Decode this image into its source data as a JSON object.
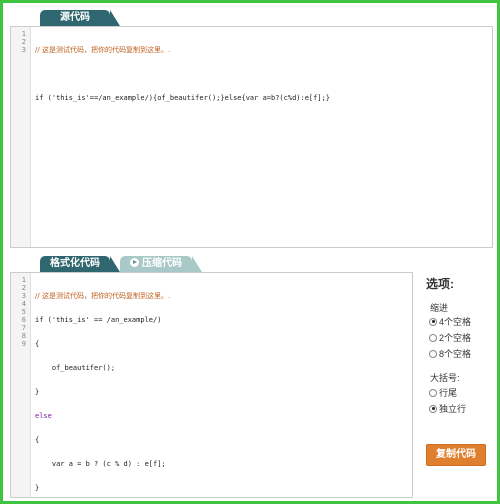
{
  "tabs": {
    "source": "源代码",
    "formatted": "格式化代码",
    "minified": "压缩代码"
  },
  "source_editor": {
    "line_numbers": [
      "1",
      "2",
      "3"
    ],
    "lines": [
      {
        "comment": "// 这是测试代码，把你的代码复制到这里。."
      },
      {
        "text": ""
      },
      {
        "text": "if ('this_is'==/an_example/){of_beautifer();}else{var a=b?(c%d):e[f];}"
      }
    ]
  },
  "formatted_editor": {
    "line_numbers": [
      "1",
      "2",
      "3",
      "4",
      "5",
      "6",
      "7",
      "8",
      "9"
    ],
    "line1_comment": "// 这是测试代码，把你的代码复制到这里。.",
    "line2": "if ('this_is' == /an_example/)",
    "line3": "{",
    "line4": "    of_beautifer();",
    "line5": "}",
    "line6": "else",
    "line7": "{",
    "line8": "    var a = b ? (c % d) : e[f];",
    "line9": "}"
  },
  "options": {
    "title": "选项:",
    "indent_label": "缩进",
    "indent_options": [
      "4个空格",
      "2个空格",
      "8个空格"
    ],
    "indent_selected": 0,
    "brace_label": "大括号:",
    "brace_options": [
      "行尾",
      "独立行"
    ],
    "brace_selected": 1
  },
  "copy_button": "复制代码"
}
